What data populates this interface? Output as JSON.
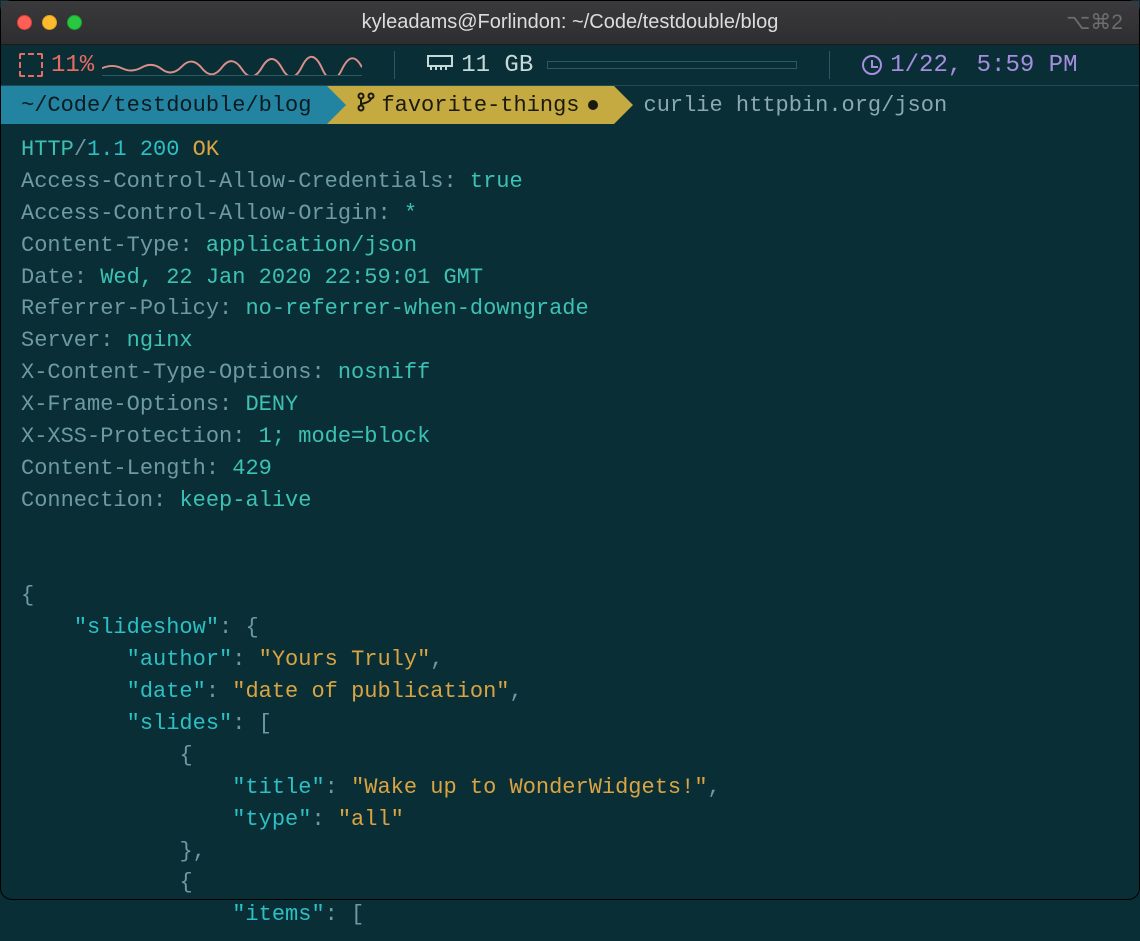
{
  "window": {
    "title": "kyleadams@Forlindon: ~/Code/testdouble/blog",
    "shortcut_hint": "⌥⌘2"
  },
  "status": {
    "cpu_pct": "11%",
    "mem": "11 GB",
    "datetime": "1/22, 5:59 PM"
  },
  "prompt": {
    "path": "~/Code/testdouble/blog",
    "branch": "favorite-things",
    "command": "curlie httpbin.org/json"
  },
  "http": {
    "protocol": "HTTP",
    "version": "1.1",
    "code": "200",
    "status": "OK",
    "headers": [
      {
        "k": "Access-Control-Allow-Credentials",
        "v": "true"
      },
      {
        "k": "Access-Control-Allow-Origin",
        "v": "*"
      },
      {
        "k": "Content-Type",
        "v": "application/json"
      },
      {
        "k": "Date",
        "v": "Wed, 22 Jan 2020 22:59:01 GMT"
      },
      {
        "k": "Referrer-Policy",
        "v": "no-referrer-when-downgrade"
      },
      {
        "k": "Server",
        "v": "nginx"
      },
      {
        "k": "X-Content-Type-Options",
        "v": "nosniff"
      },
      {
        "k": "X-Frame-Options",
        "v": "DENY"
      },
      {
        "k": "X-XSS-Protection",
        "v": "1; mode=block"
      },
      {
        "k": "Content-Length",
        "v": "429"
      },
      {
        "k": "Connection",
        "v": "keep-alive"
      }
    ]
  },
  "json_body": {
    "open_brace": "{",
    "l1_key": "\"slideshow\"",
    "l1_colon_brace": ": {",
    "l2_author_k": "\"author\"",
    "l2_author_v": "\"Yours Truly\"",
    "l2_date_k": "\"date\"",
    "l2_date_v": "\"date of publication\"",
    "l2_slides_k": "\"slides\"",
    "l2_slides_open": ": [",
    "l3_brace_open": "{",
    "l4_title_k": "\"title\"",
    "l4_title_v": "\"Wake up to WonderWidgets!\"",
    "l4_type_k": "\"type\"",
    "l4_type_v": "\"all\"",
    "l3_brace_close": "},",
    "l3_brace_open2": "{",
    "l4_items_k": "\"items\"",
    "l4_items_open": ": ["
  }
}
